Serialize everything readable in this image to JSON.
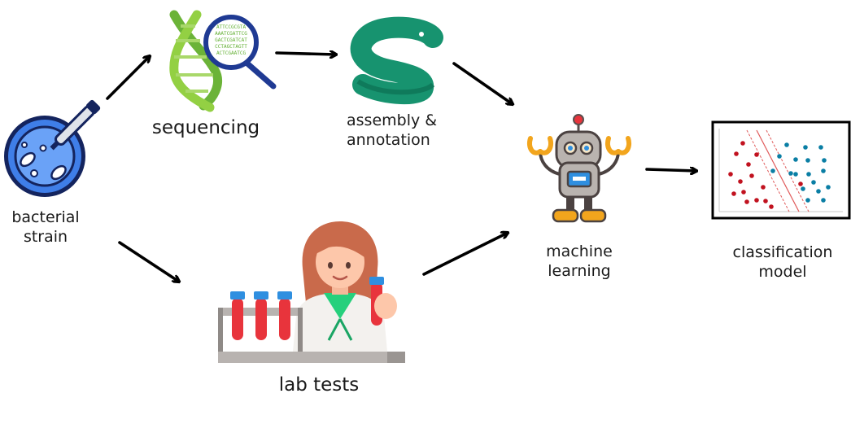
{
  "nodes": {
    "bacterial_strain": "bacterial\nstrain",
    "sequencing": "sequencing",
    "assembly": "assembly &\nannotation",
    "machine_learning": "machine\nlearning",
    "classification": "classification\nmodel",
    "lab_tests": "lab tests"
  },
  "dna_text": [
    "ATTCCGCGTA",
    "AAATCGATTCG",
    "GACTCGATCAT",
    "CCTAGCTAGTT",
    "ACTCGAATCG"
  ],
  "colors": {
    "arrow": "#000000",
    "petri": "#3f7ee8",
    "dna": "#8dc63f",
    "lens": "#1f3a93",
    "snake": "#17936f",
    "robot": "#b0aaa6",
    "robot_accent": "#f2a51d",
    "tube": "#e8343c",
    "tube_cap": "#2f8fe0",
    "coat_green": "#26d07c",
    "hair": "#c96a4b",
    "red_points": "#c1121f",
    "blue_points": "#0a7ea4"
  },
  "icons": {
    "bacterial_strain": "petri-dish-icon",
    "sequencing": "dna-magnifier-icon",
    "assembly": "snake-logo-icon",
    "machine_learning": "robot-icon",
    "classification": "scatter-plot-icon",
    "lab_tests": "scientist-icon"
  }
}
